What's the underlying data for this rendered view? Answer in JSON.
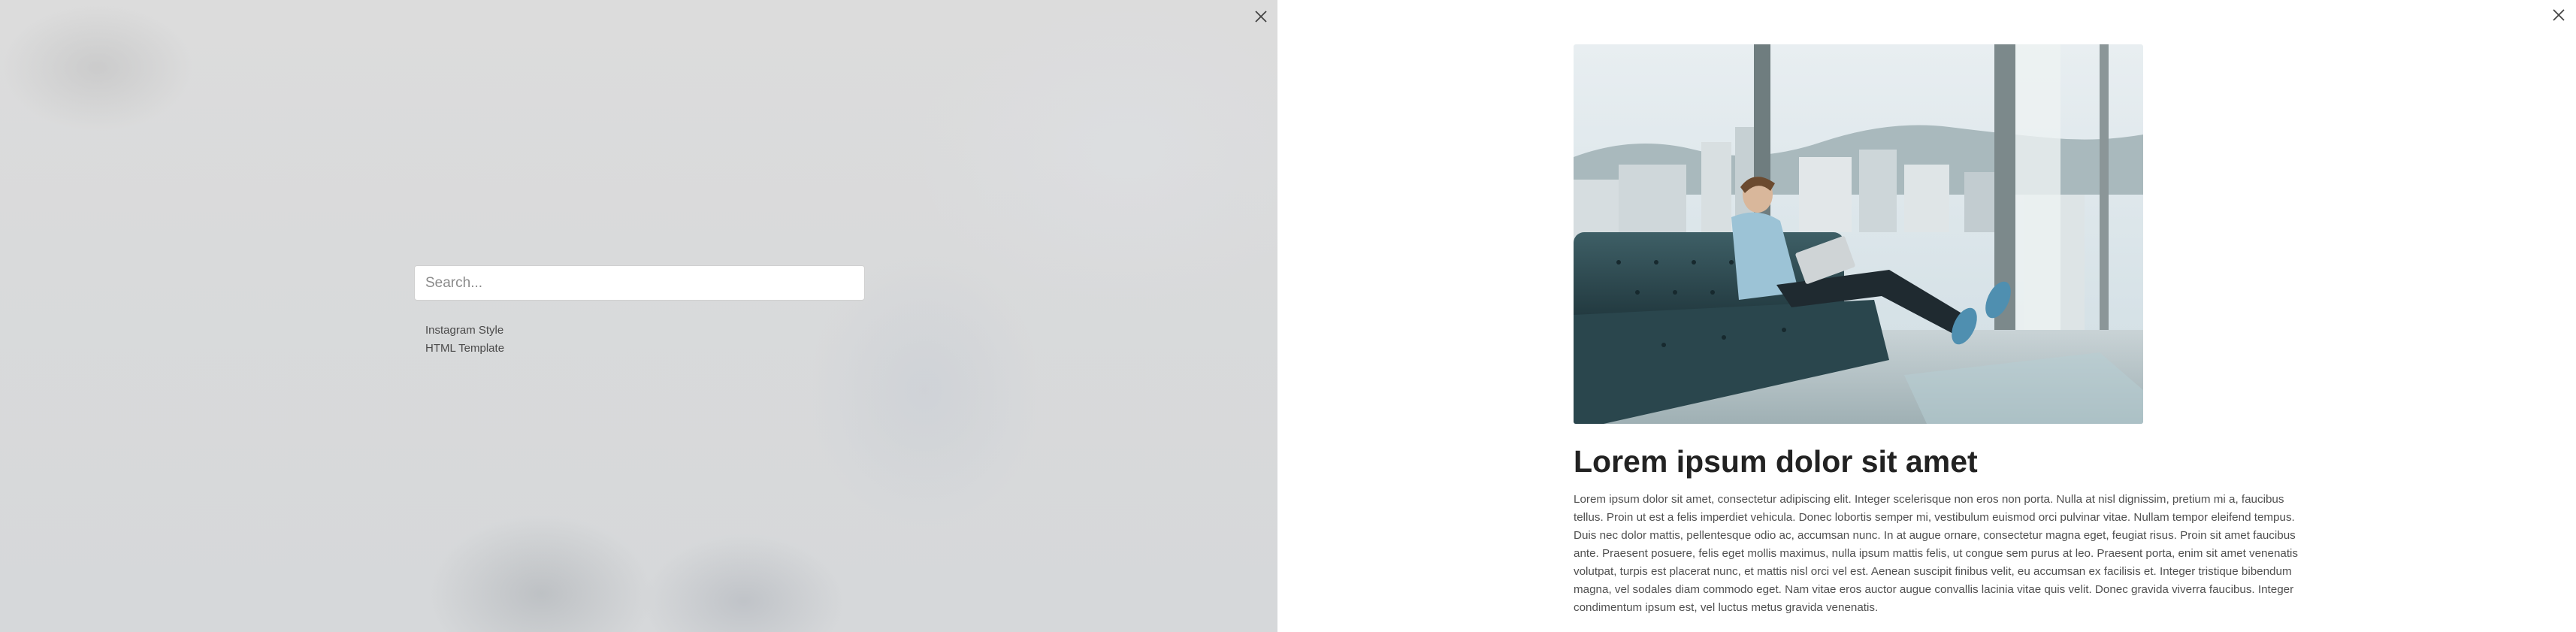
{
  "search_overlay": {
    "search_placeholder": "Search...",
    "search_value": "",
    "close_icon": "close-icon",
    "results": [
      {
        "label": "Instagram Style"
      },
      {
        "label": "HTML Template"
      }
    ]
  },
  "article": {
    "close_icon": "close-icon",
    "hero_image": "man-on-leather-sofa-with-laptop-by-city-window",
    "title": "Lorem ipsum dolor sit amet",
    "body": "Lorem ipsum dolor sit amet, consectetur adipiscing elit. Integer scelerisque non eros non porta. Nulla at nisl dignissim, pretium mi a, faucibus tellus. Proin ut est a felis imperdiet vehicula. Donec lobortis semper mi, vestibulum euismod orci pulvinar vitae. Nullam tempor eleifend tempus. Duis nec dolor mattis, pellentesque odio ac, accumsan nunc. In at augue ornare, consectetur magna eget, feugiat risus. Proin sit amet faucibus ante. Praesent posuere, felis eget mollis maximus, nulla ipsum mattis felis, ut congue sem purus at leo. Praesent porta, enim sit amet venenatis volutpat, turpis est placerat nunc, et mattis nisl orci vel est. Aenean suscipit finibus velit, eu accumsan ex facilisis et. Integer tristique bibendum magna, vel sodales diam commodo eget. Nam vitae eros auctor augue convallis lacinia vitae quis velit. Donec gravida viverra faucibus. Integer condimentum ipsum est, vel luctus metus gravida venenatis."
  },
  "colors": {
    "overlay_bg": "#d9dadb",
    "title_text": "#222222",
    "body_text": "#4f4f4f",
    "result_text": "#4a4a4a"
  }
}
